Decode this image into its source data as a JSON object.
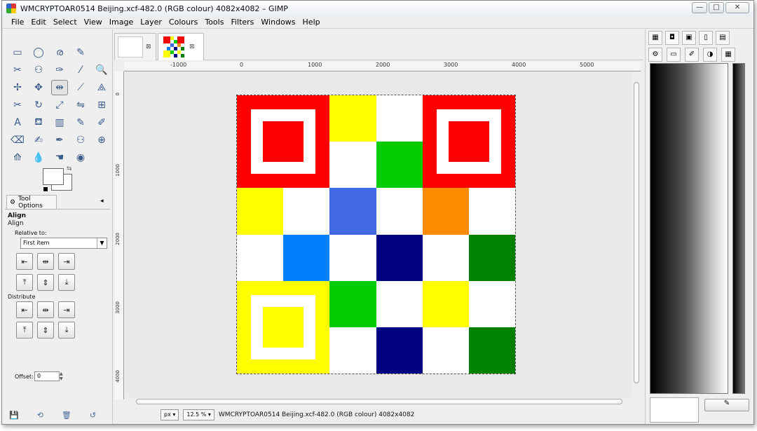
{
  "window": {
    "title": "WMCRYPTOAR0514 Beijing.xcf-482.0 (RGB colour) 4082x4082 – GIMP",
    "minimize": "—",
    "maximize": "□",
    "close": "✕"
  },
  "menu": [
    "File",
    "Edit",
    "Select",
    "View",
    "Image",
    "Layer",
    "Colours",
    "Tools",
    "Filters",
    "Windows",
    "Help"
  ],
  "toolbox": {
    "tools": [
      "rect-select-icon",
      "ellipse-select-icon",
      "lasso-icon",
      "fuzzy-select-icon",
      "",
      "scissors-icon",
      "foreground-select-icon",
      "paths-icon",
      "color-picker-icon",
      "zoom-icon",
      "measure-icon",
      "move-icon",
      "align-icon",
      "shear-icon",
      "perspective-icon",
      "crop-icon",
      "rotate-icon",
      "scale-icon",
      "flip-icon",
      "cage-icon",
      "text-icon",
      "bucket-fill-icon",
      "blend-icon",
      "pencil-icon",
      "paintbrush-icon",
      "eraser-icon",
      "airbrush-icon",
      "ink-icon",
      "clone-icon",
      "heal-icon",
      "perspective-clone-icon",
      "blur-icon",
      "smudge-icon",
      "dodge-burn-icon"
    ],
    "tool_glyphs": [
      "▭",
      "◯",
      "ര",
      "✎",
      "",
      "✂",
      "⚇",
      "✑",
      "⁄",
      "🔍",
      "✢",
      "✥",
      "⇹",
      "⟋",
      "⟁",
      "✂",
      "↻",
      "⤢",
      "⇋",
      "⊞",
      "A",
      "⛾",
      "▥",
      "✎",
      "✐",
      "⌫",
      "✍",
      "✒",
      "⚇",
      "⊕",
      "⟰",
      "💧",
      "☚",
      "◉"
    ],
    "fg_color": "#000000",
    "bg_color": "#ffffff"
  },
  "tool_options": {
    "tab_label": "Tool Options",
    "heading": "Align",
    "subheading": "Align",
    "relative_label": "Relative to:",
    "relative_value": "First item",
    "distribute_label": "Distribute",
    "offset_label": "Offset:",
    "offset_value": "0",
    "align_buttons": [
      "⇤",
      "⇹",
      "⇥",
      "⤒",
      "⇕",
      "⤓"
    ],
    "distribute_buttons": [
      "⇤",
      "⇹",
      "⇥",
      "⤒",
      "⇕",
      "⤓"
    ]
  },
  "ruler": {
    "h_labels": [
      "-1000",
      "0",
      "1000",
      "2000",
      "3000",
      "4000",
      "5000"
    ],
    "v_labels": [
      "0",
      "1000",
      "2000",
      "3000",
      "4000"
    ]
  },
  "status": {
    "unit": "px",
    "zoom": "12.5 %",
    "text": "WMCRYPTOAR0514 Beijing.xcf-482.0 (RGB colour) 4082x4082"
  },
  "image": {
    "colors": {
      "red": "#ff0000",
      "yellow": "#ffff00",
      "green": "#00cc00",
      "royal": "#4169e1",
      "orange": "#ff8c00",
      "azure": "#0080ff",
      "navy": "#000080",
      "darkgreen": "#008000",
      "white": "#ffffff"
    },
    "grid": [
      [
        "F",
        "F",
        "yellow",
        "white",
        "F2",
        "F2"
      ],
      [
        "F",
        "F",
        "white",
        "green",
        "F2",
        "F2"
      ],
      [
        "yellow",
        "white",
        "royal",
        "white",
        "orange",
        "white"
      ],
      [
        "white",
        "azure",
        "white",
        "navy",
        "white",
        "darkgreen"
      ],
      [
        "F3",
        "F3",
        "green",
        "white",
        "yellow",
        "white"
      ],
      [
        "F3",
        "F3",
        "white",
        "navy",
        "white",
        "darkgreen"
      ]
    ]
  }
}
